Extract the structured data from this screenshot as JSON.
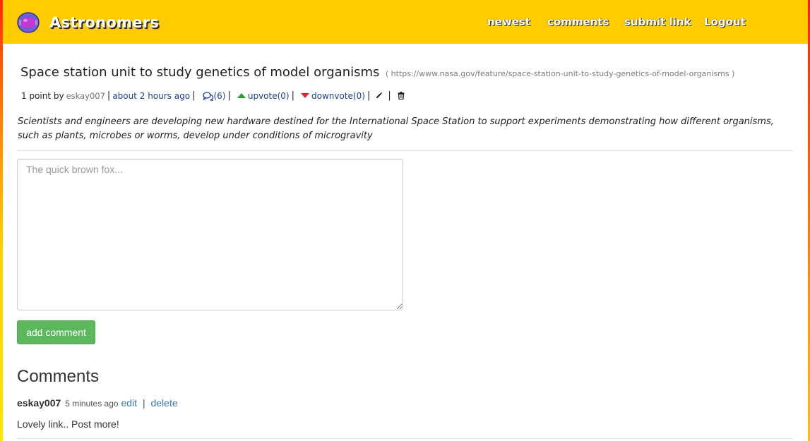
{
  "navbar": {
    "brand": "Astronomers",
    "links": [
      "newest",
      "comments",
      "submit link",
      "Logout"
    ]
  },
  "post": {
    "title": "Space station unit to study genetics of model organisms",
    "url": "( https://www.nasa.gov/feature/space-station-unit-to-study-genetics-of-model-organisms )",
    "points": "1 point by",
    "author": "eskay007",
    "time": "about 2 hours ago",
    "comment_count": "(6)",
    "upvote": "upvote(0)",
    "downvote": "downvote(0)",
    "description": "Scientists and engineers are developing new hardware destined for the International Space Station to support experiments demonstrating how different organisms, such as plants, microbes or worms, develop under conditions of microgravity"
  },
  "comment_form": {
    "placeholder": "The quick brown fox...",
    "value": "",
    "submit_label": "add comment"
  },
  "comments": {
    "heading": "Comments",
    "items": [
      {
        "author": "eskay007",
        "time": "5 minutes ago",
        "edit": "edit",
        "separator": "|",
        "delete": "delete",
        "body": "Lovely link.. Post more!"
      }
    ]
  },
  "colors": {
    "navbar": "#ffcc00",
    "upvote": "#2e9b2e",
    "downvote": "#d82a2a",
    "button": "#5cb85c",
    "link": "#337ab7"
  }
}
